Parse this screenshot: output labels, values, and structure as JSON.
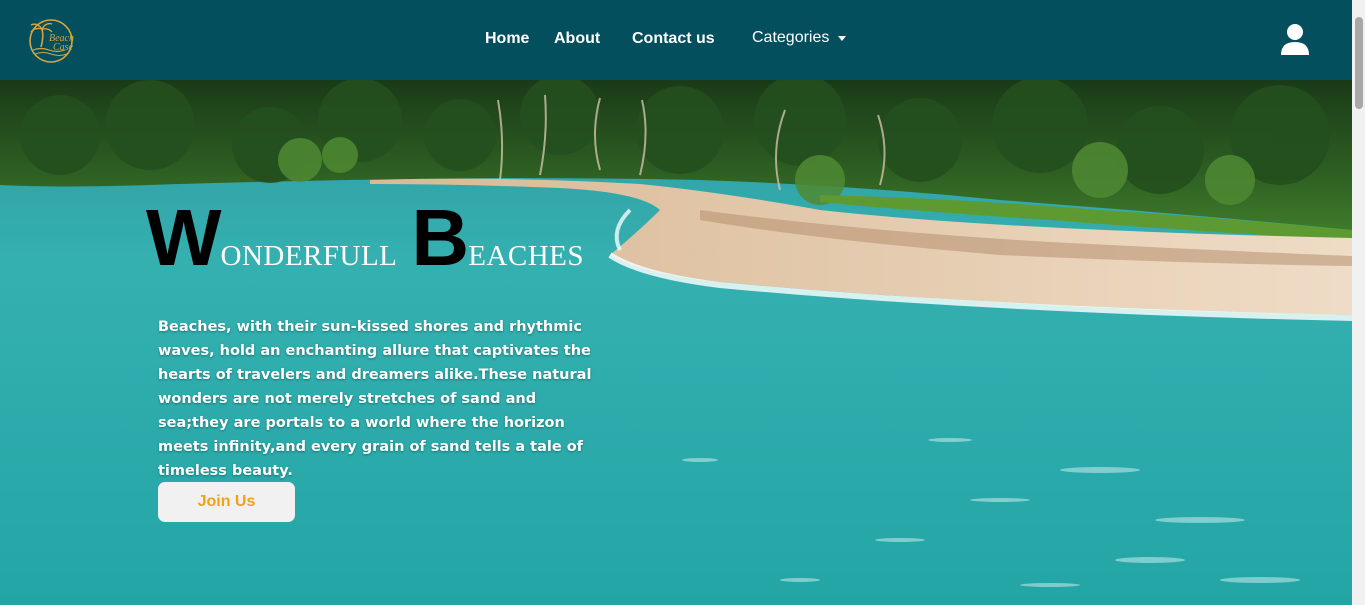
{
  "header": {
    "logo": {
      "line1": "Beach",
      "line2": "Case",
      "icon": "palm-tree-logo"
    },
    "nav": {
      "home": "Home",
      "about": "About",
      "contact": "Contact us",
      "categories": "Categories"
    },
    "user_icon": "user-icon"
  },
  "hero": {
    "title": {
      "word1_cap": "W",
      "word1_rest": "ONDERFULL",
      "word2_cap": "B",
      "word2_rest": "EACHES"
    },
    "description": "Beaches, with their sun-kissed shores and rhythmic waves, hold an enchanting allure that captivates the hearts of travelers and dreamers alike.These natural wonders are not merely stretches of sand and sea;they are portals to a world where the horizon meets infinity,and every grain of sand tells a tale of timeless beauty.",
    "cta_label": "Join Us"
  },
  "colors": {
    "navbar": "#034f5e",
    "cta_text": "#f2a213",
    "cta_bg": "#f1f1f1",
    "sea": "#2aa7a8",
    "sand": "#e8cfae",
    "jungle": "#1f4a1c"
  }
}
